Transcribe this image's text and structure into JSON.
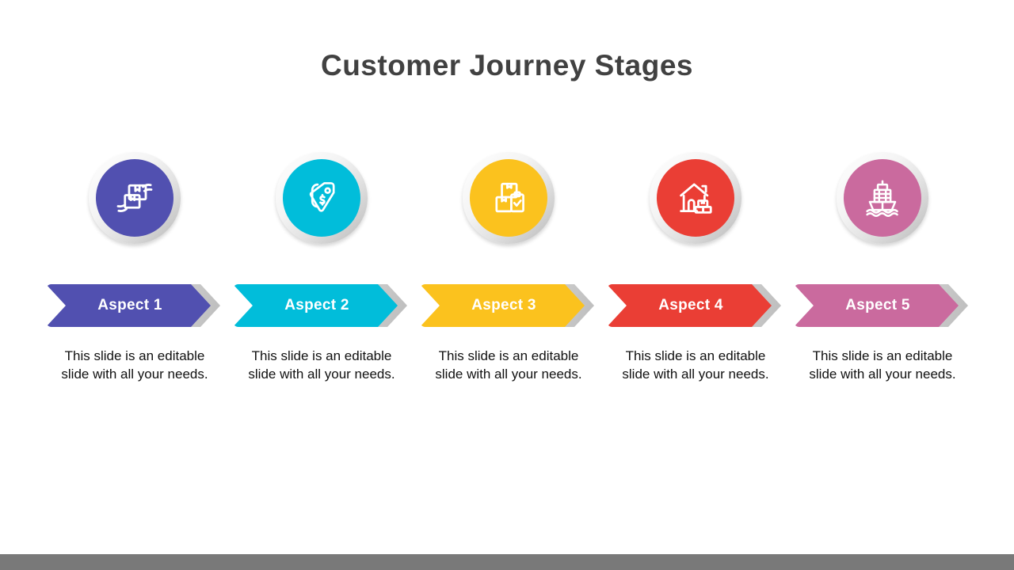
{
  "slide": {
    "title": "Customer Journey Stages",
    "background_color": "#ffffff",
    "title_color": "#414141"
  },
  "bottom_bar": {
    "color": "#797979"
  },
  "stages": [
    {
      "label": "Aspect 1",
      "description": "This slide is an editable slide with all your needs.",
      "color": "#5150b0",
      "icon": "hands-holding-package-icon"
    },
    {
      "label": "Aspect 2",
      "description": "This slide is an editable slide with all your needs.",
      "color": "#01bdda",
      "icon": "price-tag-dollar-icon"
    },
    {
      "label": "Aspect 3",
      "description": "This slide is an editable slide with all your needs.",
      "color": "#fbc21e",
      "icon": "boxes-clipboard-check-icon"
    },
    {
      "label": "Aspect 4",
      "description": "This slide is an editable slide with all your needs.",
      "color": "#ea3e35",
      "icon": "house-delivery-boxes-icon"
    },
    {
      "label": "Aspect 5",
      "description": "This slide is an editable slide with all your needs.",
      "color": "#ca6a9e",
      "icon": "cargo-ship-icon"
    }
  ]
}
